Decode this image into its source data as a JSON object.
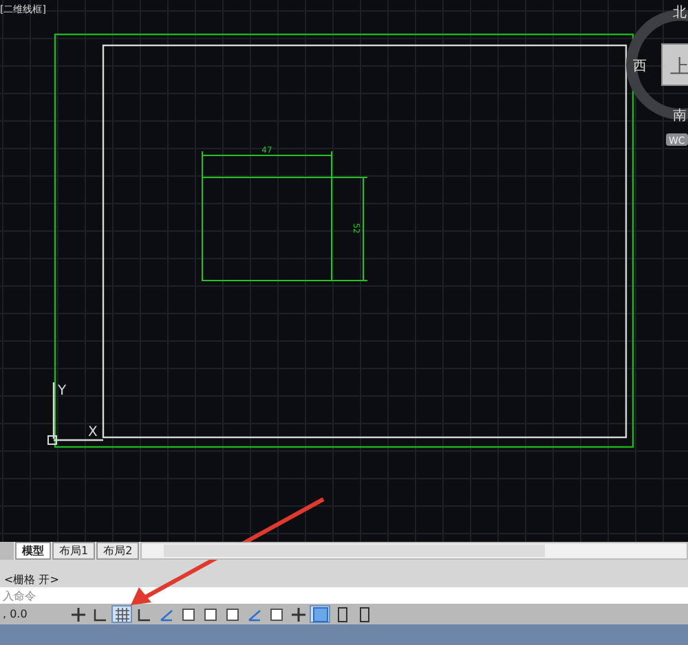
{
  "viewport": {
    "label": "[二维线框]"
  },
  "viewcube": {
    "north": "北",
    "west": "西",
    "south": "南",
    "face": "上",
    "ucs_badge": "WC"
  },
  "drawing": {
    "dim_horizontal": "47",
    "dim_vertical": "52",
    "axis_y": "Y",
    "axis_x": "X"
  },
  "layout_tabs": [
    {
      "label": "模型",
      "selected": true
    },
    {
      "label": "布局1",
      "selected": false
    },
    {
      "label": "布局2",
      "selected": false
    }
  ],
  "command_history": "<栅格 开>",
  "command_line": {
    "placeholder": "入命令"
  },
  "status_bar": {
    "coordinates": ", 0.0",
    "toggles": [
      {
        "kind": "snap",
        "selected": false
      },
      {
        "kind": "infer",
        "selected": false
      },
      {
        "kind": "grid",
        "selected": true
      },
      {
        "kind": "ortho",
        "selected": false
      },
      {
        "kind": "polar",
        "selected": false
      },
      {
        "kind": "osnap",
        "selected": false
      },
      {
        "kind": "osnap3d",
        "selected": false
      },
      {
        "kind": "otrack",
        "selected": false
      },
      {
        "kind": "ducs",
        "selected": false
      },
      {
        "kind": "dyn",
        "selected": false
      },
      {
        "kind": "lwt",
        "selected": false
      },
      {
        "kind": "tpy",
        "selected": true
      },
      {
        "kind": "qp",
        "selected": false
      },
      {
        "kind": "sc",
        "selected": false
      }
    ]
  }
}
